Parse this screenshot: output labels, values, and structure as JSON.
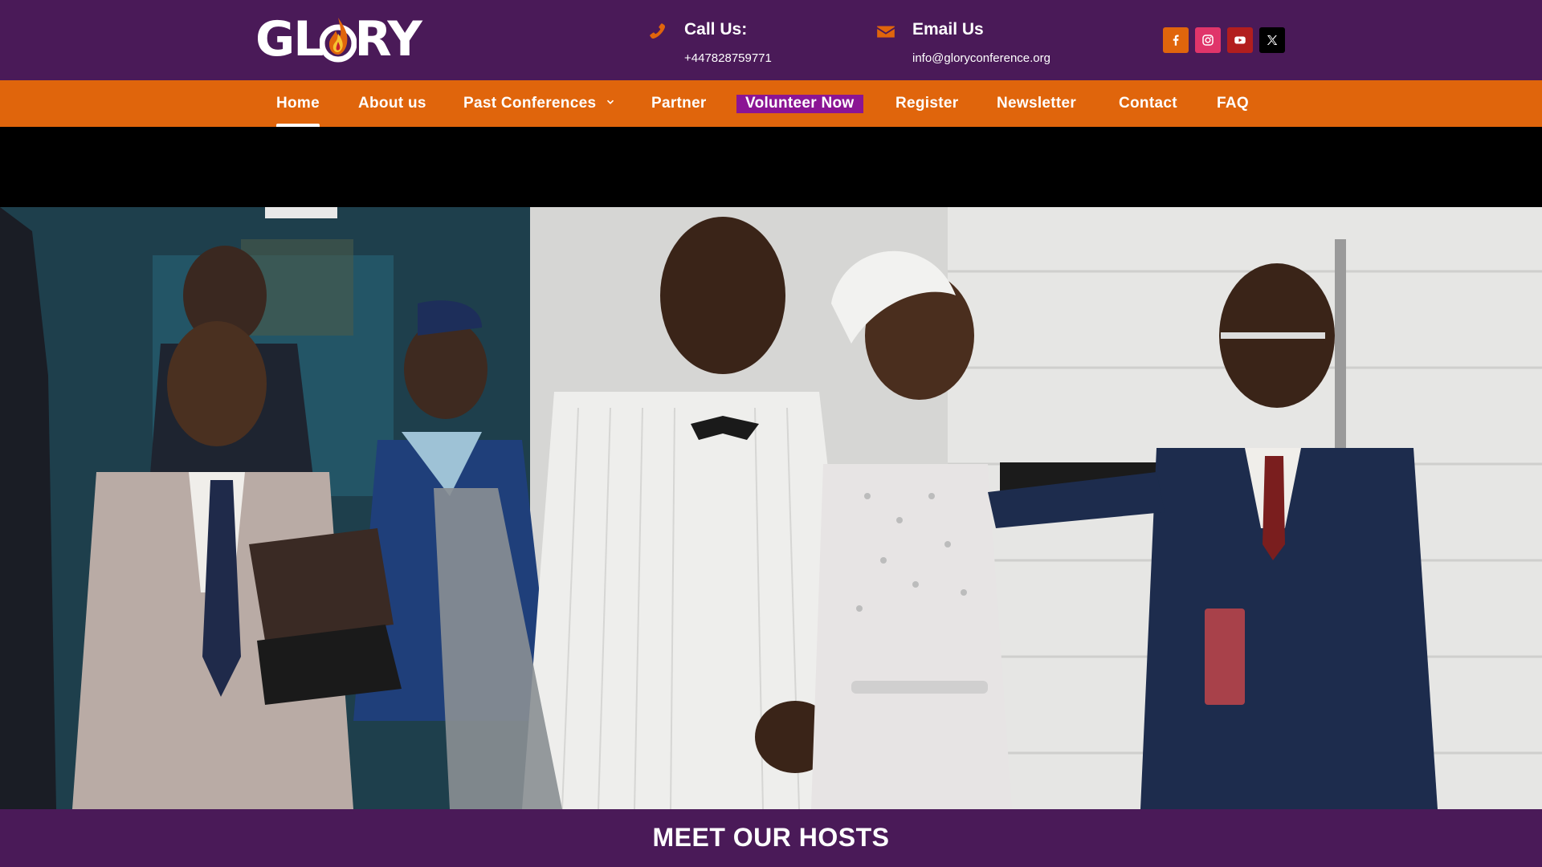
{
  "header": {
    "logo_text_left": "GL",
    "logo_text_right": "RY",
    "logo_alt": "GLORY",
    "call": {
      "title": "Call Us:",
      "value": "+447828759771"
    },
    "email": {
      "title": "Email Us",
      "value": "info@gloryconference.org"
    },
    "socials": [
      {
        "name": "facebook",
        "glyph": "f",
        "color": "#e0650c"
      },
      {
        "name": "instagram",
        "color": "#e0356a"
      },
      {
        "name": "youtube",
        "color": "#b21e1e"
      },
      {
        "name": "x",
        "color": "#000000"
      }
    ]
  },
  "nav": {
    "items": [
      {
        "label": "Home",
        "active": true
      },
      {
        "label": "About us"
      },
      {
        "label": "Past Conferences",
        "has_dropdown": true
      },
      {
        "label": "Partner"
      },
      {
        "label": "Volunteer Now",
        "highlighted": true
      },
      {
        "label": "Register"
      },
      {
        "label": "Newsletter"
      },
      {
        "label": "Contact"
      },
      {
        "label": "FAQ"
      }
    ]
  },
  "sections": {
    "hosts_title": "MEET OUR HOSTS"
  },
  "colors": {
    "purple": "#4a1a58",
    "orange": "#e0650c",
    "highlight": "#8b1594"
  }
}
